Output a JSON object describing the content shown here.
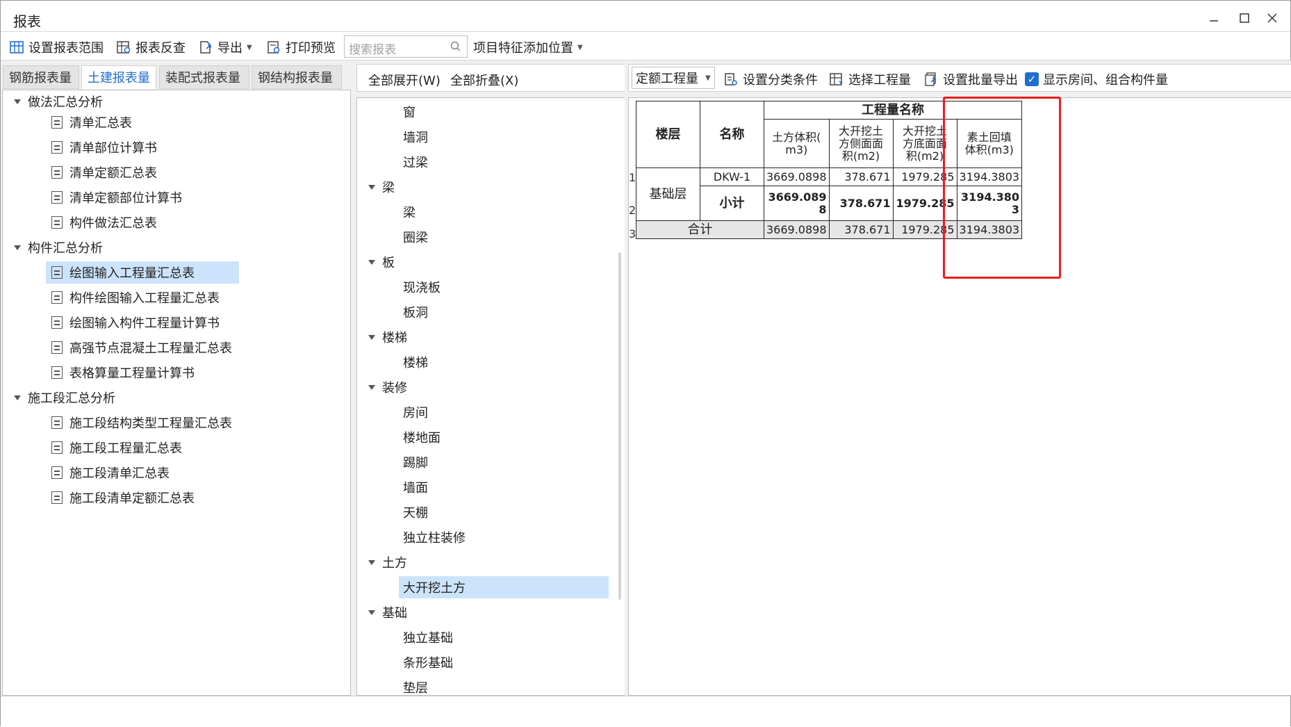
{
  "window": {
    "title": "报表"
  },
  "toolbar": {
    "set_range": "设置报表范围",
    "reverse_check": "报表反查",
    "export": "导出",
    "print_preview": "打印预览",
    "search_placeholder": "搜索报表",
    "feature_position": "项目特征添加位置"
  },
  "tabs": [
    "钢筋报表量",
    "土建报表量",
    "装配式报表量",
    "钢结构报表量"
  ],
  "left_tree": {
    "group1": "做法汇总分析",
    "group1_items": [
      "清单汇总表",
      "清单部位计算书",
      "清单定额汇总表",
      "清单定额部位计算书",
      "构件做法汇总表"
    ],
    "group2": "构件汇总分析",
    "group2_items": [
      "绘图输入工程量汇总表",
      "构件绘图输入工程量汇总表",
      "绘图输入构件工程量计算书",
      "高强节点混凝土工程量汇总表",
      "表格算量工程量计算书"
    ],
    "group3": "施工段汇总分析",
    "group3_items": [
      "施工段结构类型工程量汇总表",
      "施工段工程量汇总表",
      "施工段清单汇总表",
      "施工段清单定额汇总表"
    ]
  },
  "mid": {
    "expand_all": "全部展开(W)",
    "collapse_all": "全部折叠(X)",
    "items": {
      "window": "窗",
      "wall_hole": "墙洞",
      "lintel": "过梁",
      "beam_group": "梁",
      "beam": "梁",
      "ring_beam": "圈梁",
      "slab_group": "板",
      "cast_slab": "现浇板",
      "slab_hole": "板洞",
      "stair_group": "楼梯",
      "stair": "楼梯",
      "deco_group": "装修",
      "room": "房间",
      "floor": "楼地面",
      "skirting": "踢脚",
      "wall_face": "墙面",
      "ceiling": "天棚",
      "column_deco": "独立柱装修",
      "earth_group": "土方",
      "excavation": "大开挖土方",
      "found_group": "基础",
      "isolated_found": "独立基础",
      "strip_found": "条形基础",
      "cushion": "垫层"
    }
  },
  "right_bar": {
    "quota": "定额工程量",
    "classify": "设置分类条件",
    "select_qty": "选择工程量",
    "batch_export": "设置批量导出",
    "show_room": "显示房间、组合构件量"
  },
  "report": {
    "h_floor": "楼层",
    "h_name": "名称",
    "h_group": "工程量名称",
    "cols": [
      "土方体积(m3)",
      "大开挖土方侧面面积(m2)",
      "大开挖土方底面面积(m2)",
      "素土回填体积(m3)"
    ],
    "col_lines": [
      [
        "土方体积(",
        "m3)"
      ],
      [
        "大开挖土",
        "方侧面面",
        "积(m2)"
      ],
      [
        "大开挖土",
        "方底面面",
        "积(m2)"
      ],
      [
        "素土回填",
        "体积(m3)"
      ]
    ],
    "floor_name": "基础层",
    "row1": {
      "num": "1",
      "name": "DKW-1",
      "v1": "3669.0898",
      "v2": "378.671",
      "v3": "1979.285",
      "v4": "3194.3803"
    },
    "row2": {
      "num": "2",
      "name": "小计",
      "v1a": "3669.089",
      "v1b": "8",
      "v2": "378.671",
      "v3": "1979.285",
      "v4a": "3194.380",
      "v4b": "3"
    },
    "row3": {
      "num": "3",
      "name": "合计",
      "v1": "3669.0898",
      "v2": "378.671",
      "v3": "1979.285",
      "v4": "3194.3803"
    }
  },
  "colors": {
    "accent": "#1f6fd1",
    "selection": "#cce4fb",
    "highlight": "#ee1c1c"
  }
}
